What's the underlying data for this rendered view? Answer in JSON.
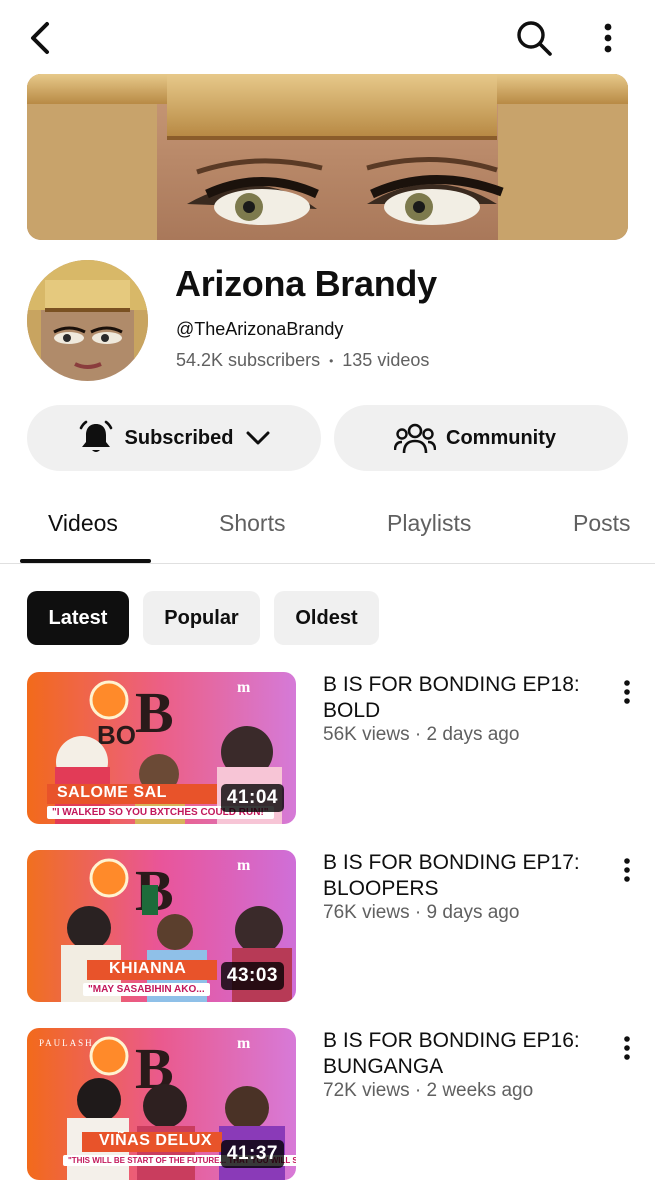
{
  "header": {
    "back_icon": "back-arrow-icon",
    "search_icon": "search-icon",
    "more_icon": "more-vertical-icon"
  },
  "channel": {
    "name": "Arizona Brandy",
    "handle": "@TheArizonaBrandy",
    "subscribers": "54.2K subscribers",
    "separator": "•",
    "video_count": "135 videos"
  },
  "actions": {
    "subscribed_label": "Subscribed",
    "community_label": "Community"
  },
  "tabs": [
    {
      "label": "Videos",
      "active": true
    },
    {
      "label": "Shorts",
      "active": false
    },
    {
      "label": "Playlists",
      "active": false
    },
    {
      "label": "Posts",
      "active": false
    }
  ],
  "filters": [
    {
      "label": "Latest",
      "active": true
    },
    {
      "label": "Popular",
      "active": false
    },
    {
      "label": "Oldest",
      "active": false
    }
  ],
  "videos": [
    {
      "title": "B IS FOR BONDING EP18: BOLD",
      "meta": "56K views · 2 days ago",
      "duration": "41:04",
      "thumb_caption": "SALOME SAL",
      "thumb_quote": "\"I WALKED SO YOU BXTCHES COULD RUN!\""
    },
    {
      "title": "B IS FOR BONDING EP17: BLOOPERS",
      "meta": "76K views · 9 days ago",
      "duration": "43:03",
      "thumb_caption": "KHIANNA",
      "thumb_quote": "\"MAY SASABIHIN AKO..."
    },
    {
      "title": "B IS FOR BONDING EP16: BUNGANGA",
      "meta": "72K views · 2 weeks ago",
      "duration": "41:37",
      "thumb_caption": "VIÑAS DELUX",
      "thumb_quote": "\"THIS WILL BE START OF THE FUTURE... THAT YOU WILL SEE!\""
    }
  ],
  "colors": {
    "text_primary": "#0f0f0f",
    "text_secondary": "#606060",
    "chip_bg": "#f0f0f0",
    "active_chip_bg": "#0f0f0f"
  }
}
